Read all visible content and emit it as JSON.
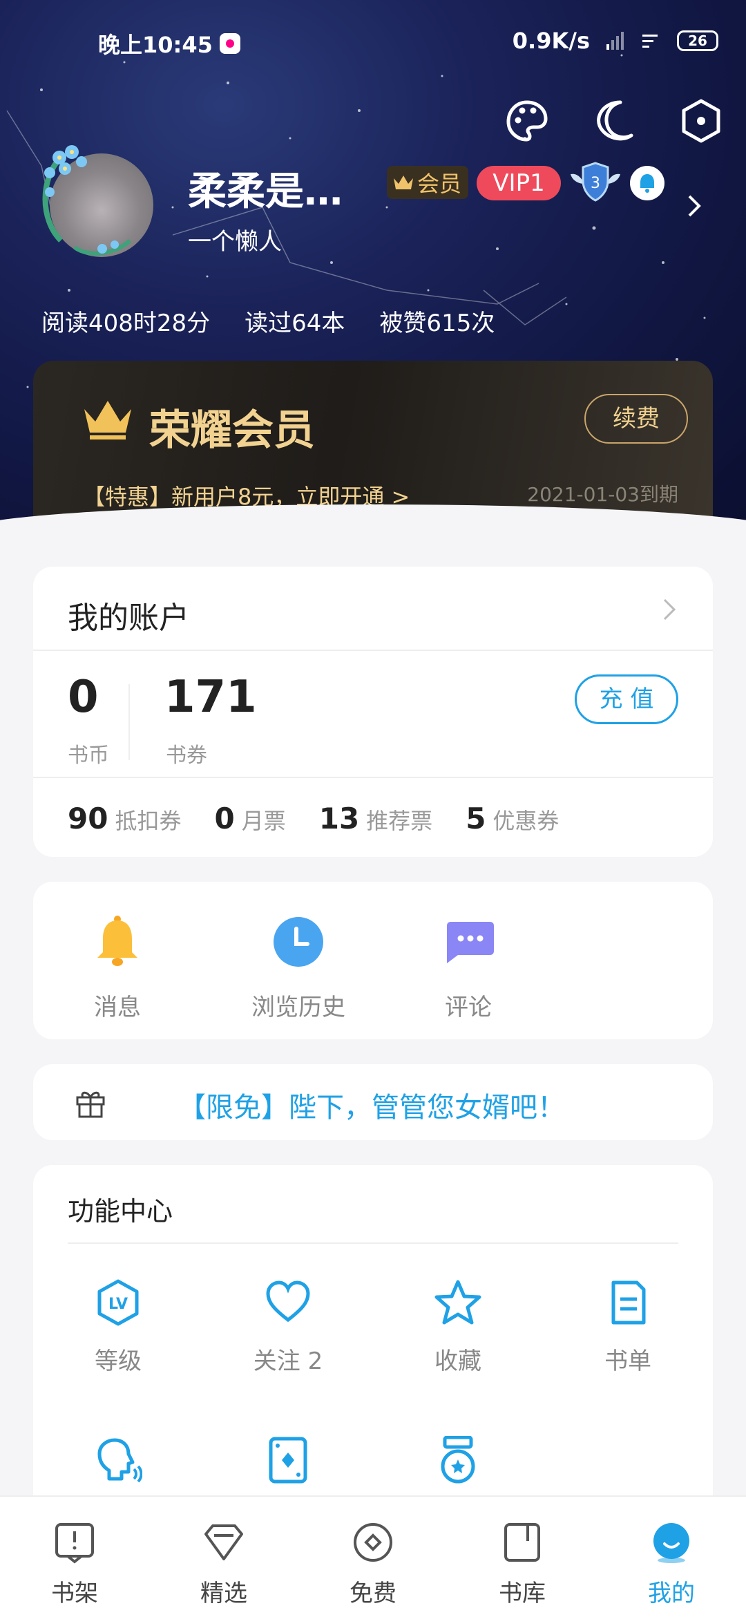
{
  "status_bar": {
    "time": "晚上10:45",
    "network_speed": "0.9K/s",
    "battery": "26"
  },
  "profile": {
    "name": "柔柔是…",
    "signature": "一个懒人",
    "member_badge": "会员",
    "vip_badge": "VIP1",
    "level_badge": "3",
    "stats": {
      "read_time": "阅读408时28分",
      "books_read": "读过64本",
      "likes": "被赞615次"
    }
  },
  "vip_card": {
    "title": "荣耀会员",
    "renew_label": "续费",
    "promo": "【特惠】新用户8元，立即开通 >",
    "expire": "2021-01-03到期"
  },
  "account": {
    "title": "我的账户",
    "coins_value": "0",
    "coins_label": "书币",
    "vouchers_value": "171",
    "vouchers_label": "书券",
    "recharge_label": "充 值",
    "coupons": [
      {
        "num": "90",
        "label": "抵扣券"
      },
      {
        "num": "0",
        "label": "月票"
      },
      {
        "num": "13",
        "label": "推荐票"
      },
      {
        "num": "5",
        "label": "优惠券"
      }
    ]
  },
  "quick_actions": [
    {
      "label": "消息",
      "icon": "bell-icon"
    },
    {
      "label": "浏览历史",
      "icon": "clock-icon"
    },
    {
      "label": "评论",
      "icon": "chat-bubble-icon"
    }
  ],
  "promo_banner": {
    "text": "【限免】陛下，管管您女婿吧！"
  },
  "function_center": {
    "title": "功能中心",
    "items": [
      {
        "label": "等级",
        "icon": "level-icon"
      },
      {
        "label": "关注 2",
        "icon": "heart-icon"
      },
      {
        "label": "收藏",
        "icon": "star-icon"
      },
      {
        "label": "书单",
        "icon": "booklist-icon"
      },
      {
        "label": "",
        "icon": "voice-icon"
      },
      {
        "label": "",
        "icon": "card-icon"
      },
      {
        "label": "",
        "icon": "medal-icon"
      }
    ]
  },
  "bottom_nav": [
    {
      "label": "书架",
      "icon": "bookshelf-icon"
    },
    {
      "label": "精选",
      "icon": "diamond-icon"
    },
    {
      "label": "免费",
      "icon": "free-icon"
    },
    {
      "label": "书库",
      "icon": "library-icon"
    },
    {
      "label": "我的",
      "icon": "profile-icon"
    }
  ],
  "colors": {
    "accent": "#1fa1e6",
    "vip_gold": "#f2d290",
    "vip_red": "#ef4a5b",
    "header_dark": "#101640"
  }
}
